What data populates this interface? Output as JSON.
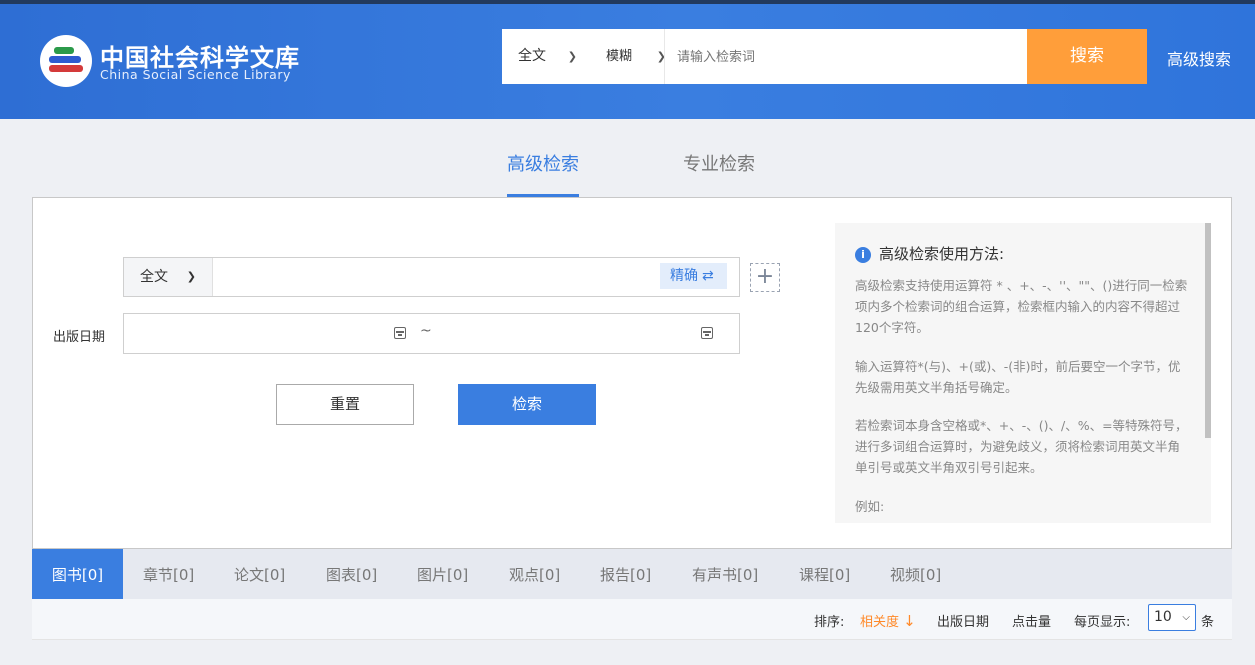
{
  "header": {
    "site_title": "中国社会科学文库",
    "site_subtitle": "China Social Science Library",
    "search": {
      "scope": "全文",
      "match": "模糊",
      "placeholder": "请输入检索词",
      "button": "搜索"
    },
    "advanced_link": "高级搜索"
  },
  "mode_tabs": {
    "advanced": "高级检索",
    "professional": "专业检索"
  },
  "form": {
    "field_select": "全文",
    "exact_toggle": "精确",
    "exact_icon": "⇄",
    "add_icon": "+",
    "date_label": "出版日期",
    "date_separator": "~",
    "reset_button": "重置",
    "search_button": "检索"
  },
  "help": {
    "title": "高级检索使用方法:",
    "p1": "高级检索支持使用运算符 * 、+、-、''、\"\"、()进行同一检索项内多个检索词的组合运算，检索框内输入的内容不得超过120个字符。",
    "p2": "输入运算符*(与)、+(或)、-(非)时，前后要空一个字节，优先级需用英文半角括号确定。",
    "p3": "若检索词本身含空格或*、+、-、()、/、%、=等特殊符号，进行多词组合运算时，为避免歧义，须将检索词用英文半角单引号或英文半角双引号引起来。",
    "p4": "例如:"
  },
  "result_tabs": [
    "图书[0]",
    "章节[0]",
    "论文[0]",
    "图表[0]",
    "图片[0]",
    "观点[0]",
    "报告[0]",
    "有声书[0]",
    "课程[0]",
    "视频[0]"
  ],
  "sort": {
    "label": "排序:",
    "relevance": "相关度",
    "relevance_arrow": "↓",
    "pub_date": "出版日期",
    "clicks": "点击量",
    "per_page_label": "每页显示:",
    "per_page_value": "10",
    "unit": "条"
  },
  "colors": {
    "primary": "#3a7ee0",
    "accent_orange": "#ff9e3a"
  }
}
